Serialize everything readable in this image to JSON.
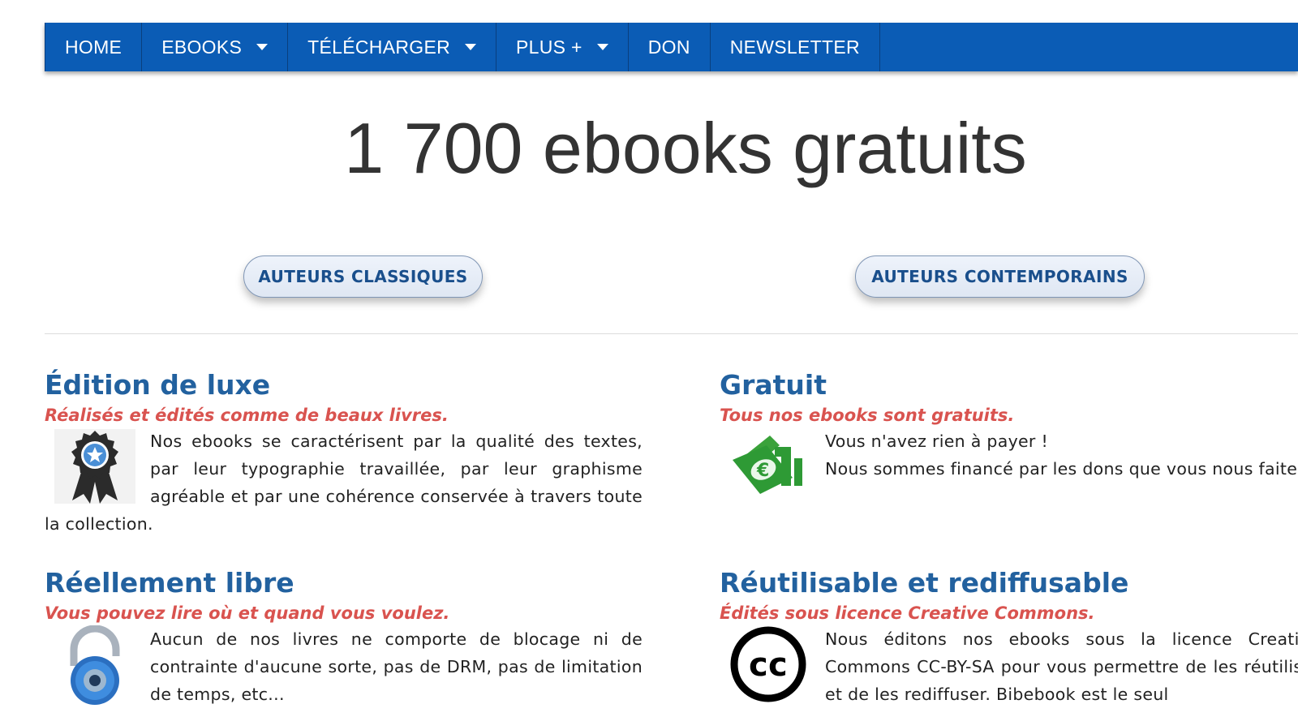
{
  "nav": {
    "items": [
      {
        "label": "HOME",
        "dropdown": false
      },
      {
        "label": "EBOOKS",
        "dropdown": true
      },
      {
        "label": "TÉLÉCHARGER",
        "dropdown": true
      },
      {
        "label": "PLUS +",
        "dropdown": true
      },
      {
        "label": "DON",
        "dropdown": false
      },
      {
        "label": "NEWSLETTER",
        "dropdown": false
      }
    ]
  },
  "hero": {
    "title": "1 700 ebooks gratuits"
  },
  "buttons": {
    "classic": "AUTEURS CLASSIQUES",
    "contemporary": "AUTEURS CONTEMPORAINS"
  },
  "features": {
    "luxe": {
      "title": "Édition de luxe",
      "subtitle": "Réalisés et édités comme de beaux livres.",
      "body": "Nos ebooks se caractérisent par la qualité des textes, par leur typographie travaillée, par leur graphisme agréable et par une cohérence conservée à travers toute la collection.",
      "icon": "award-ribbon-icon"
    },
    "gratuit": {
      "title": "Gratuit",
      "subtitle": "Tous nos ebooks sont gratuits.",
      "body_line1": "Vous n'avez rien à payer !",
      "body_line2": "Nous sommes financé par les dons que vous nous faites.",
      "icon": "euro-money-icon"
    },
    "libre": {
      "title": "Réellement libre",
      "subtitle": "Vous pouvez lire où et quand vous voulez.",
      "body": "Aucun de nos livres ne comporte de blocage ni de contrainte d'aucune sorte, pas de DRM, pas de limitation de temps, etc...",
      "icon": "open-padlock-icon"
    },
    "reuse": {
      "title": "Réutilisable et rediffusable",
      "subtitle": "Édités sous licence Creative Commons.",
      "body": "Nous éditons nos ebooks sous la licence Creative Commons CC-BY-SA pour vous permettre de les réutiliser et de les rediffuser. Bibebook est le seul",
      "icon": "creative-commons-icon"
    }
  },
  "colors": {
    "nav_bg": "#0b5cb5",
    "heading": "#22619f",
    "subtitle": "#d9534f"
  }
}
